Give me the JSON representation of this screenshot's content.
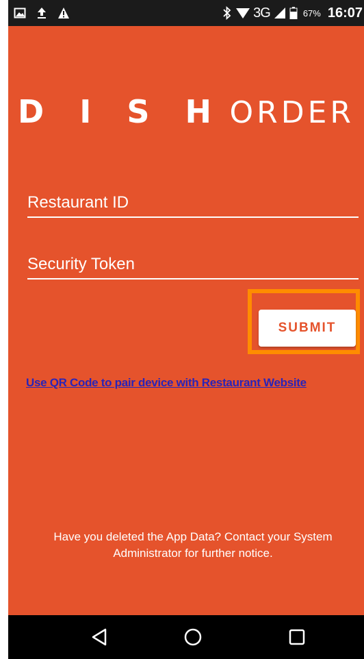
{
  "status_bar": {
    "left_icons": [
      "image-icon",
      "upload-icon",
      "warning-icon"
    ],
    "network": "3G",
    "battery": "67%",
    "time": "16:07"
  },
  "logo": {
    "word1": "D I S H",
    "word2": "ORDER"
  },
  "form": {
    "restaurant_id_placeholder": "Restaurant ID",
    "restaurant_id_value": "",
    "security_token_placeholder": "Security Token",
    "security_token_value": "",
    "submit_label": "SUBMIT"
  },
  "qr_link": "Use QR Code to pair device with Restaurant Website",
  "notice": "Have you deleted the App Data? Contact your System Administrator for further notice.",
  "nav": [
    "back-icon",
    "home-icon",
    "recent-apps-icon"
  ],
  "colors": {
    "background": "#E5532C",
    "highlight": "#FF8C00",
    "link": "#2A24B8",
    "status_bar": "#1B1B1B",
    "nav_bar": "#000000"
  }
}
